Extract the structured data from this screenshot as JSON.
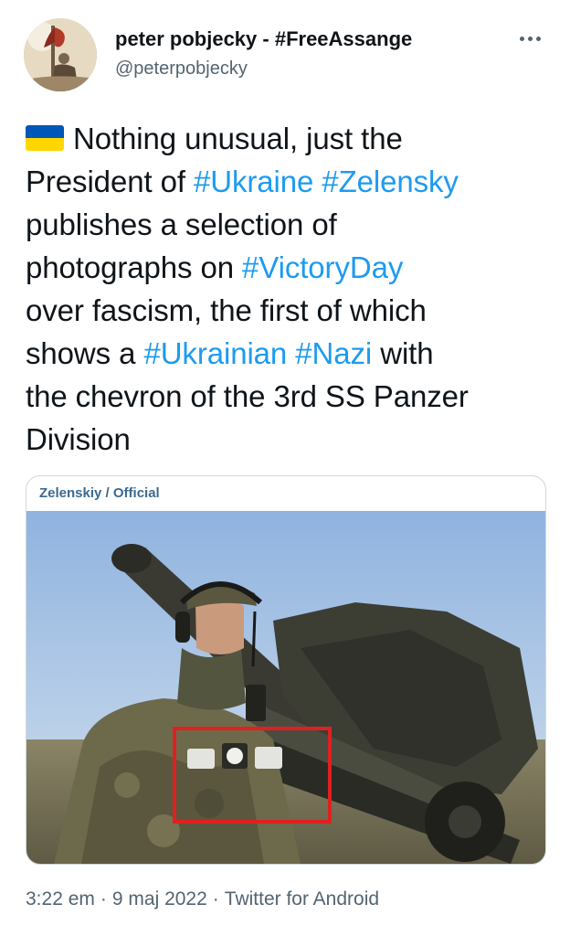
{
  "author": {
    "display_name": "peter pobjecky - #FreeAssange",
    "handle": "@peterpobjecky"
  },
  "tweet": {
    "line1_text": "Nothing unusual, just the",
    "line2_text": "President of ",
    "tag_ukraine": "#Ukraine",
    "tag_zelensky": "#Zelensky",
    "line3_text": "publishes a selection of",
    "line4_text": "photographs on ",
    "tag_victoryday": "#VictoryDay",
    "line5_text": "over fascism, the first of which",
    "line6_text": "shows a ",
    "tag_ukrainian": "#Ukrainian",
    "tag_nazi": "#Nazi",
    "line6_tail": " with",
    "line7_text": "the chevron of the 3rd SS Panzer",
    "line8_text": "Division",
    "flag_icon": "ukraine-flag-emoji"
  },
  "media": {
    "source_label": "Zelenskiy / Official",
    "highlight_color": "#e02020"
  },
  "meta": {
    "time": "3:22 em",
    "date": "9 maj 2022",
    "client": "Twitter for Android"
  },
  "colors": {
    "link": "#1d9bf0",
    "secondary_text": "#536471",
    "primary_text": "#0f1419"
  }
}
